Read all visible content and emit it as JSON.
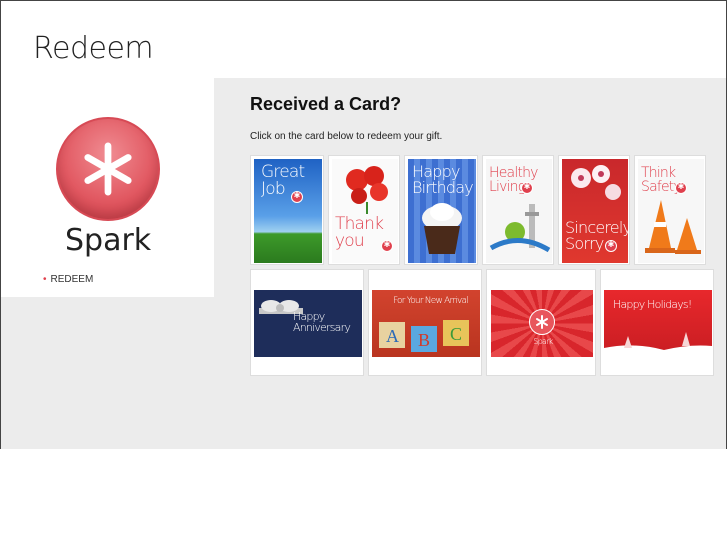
{
  "page": {
    "title": "Redeem"
  },
  "brand": {
    "name": "Spark",
    "accent": "#e0404d"
  },
  "sidebar": {
    "nav_items": [
      {
        "label": "REDEEM"
      }
    ]
  },
  "main": {
    "heading": "Received a Card?",
    "instruction": "Click on the card below to redeem your gift."
  },
  "cards_row1": [
    {
      "text": "Great Job"
    },
    {
      "text": "Thank you"
    },
    {
      "text": "Happy Birthday"
    },
    {
      "text": "Healthy Living"
    },
    {
      "text": "Sincerely Sorry"
    },
    {
      "text": "Think Safety"
    }
  ],
  "cards_row2": [
    {
      "text": "Happy Anniversary"
    },
    {
      "text": "For Your New Arrival"
    },
    {
      "text": "Spark"
    },
    {
      "text": "Happy Holidays!"
    }
  ]
}
